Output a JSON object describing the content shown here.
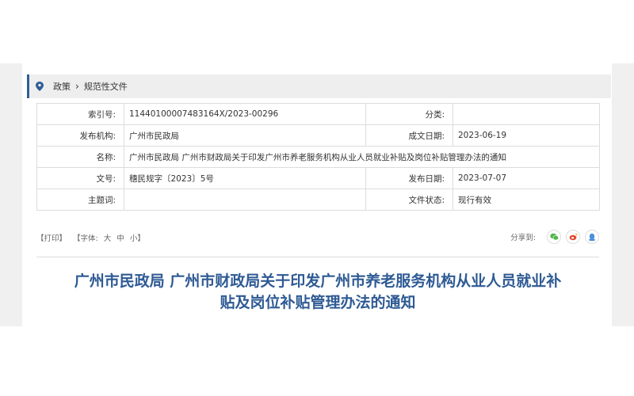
{
  "breadcrumb": {
    "crumb1": "政策",
    "separator": "›",
    "crumb2": "规范性文件"
  },
  "info": {
    "index_label": "索引号:",
    "index_value": "11440100007483164X/2023-00296",
    "category_label": "分类:",
    "category_value": "",
    "publisher_label": "发布机构:",
    "publisher_value": "广州市民政局",
    "date_written_label": "成文日期:",
    "date_written_value": "2023-06-19",
    "name_label": "名称:",
    "name_value": "广州市民政局 广州市财政局关于印发广州市养老服务机构从业人员就业补贴及岗位补贴管理办法的通知",
    "doc_no_label": "文号:",
    "doc_no_value": "穗民规字〔2023〕5号",
    "publish_date_label": "发布日期:",
    "publish_date_value": "2023-07-07",
    "subject_label": "主题词:",
    "subject_value": "",
    "status_label": "文件状态:",
    "status_value": "现行有效"
  },
  "tools": {
    "print": "【打印】",
    "font_prefix": "【字体:",
    "font_large": "大",
    "font_medium": "中",
    "font_small": "小】",
    "share_label": "分享到:"
  },
  "icons": {
    "share1": "wechat-icon",
    "share2": "weibo-icon",
    "share3": "qq-icon",
    "pin": "location-pin-icon"
  },
  "colors": {
    "title": "#2e5a94",
    "accent": "#2f5d97",
    "wechat": "#4fb548",
    "weibo": "#e0472b",
    "qq": "#4a90d9"
  },
  "title": {
    "line1": "广州市民政局 广州市财政局关于印发广州市养老服务机构从业人员就业补",
    "line2": "贴及岗位补贴管理办法的通知"
  }
}
